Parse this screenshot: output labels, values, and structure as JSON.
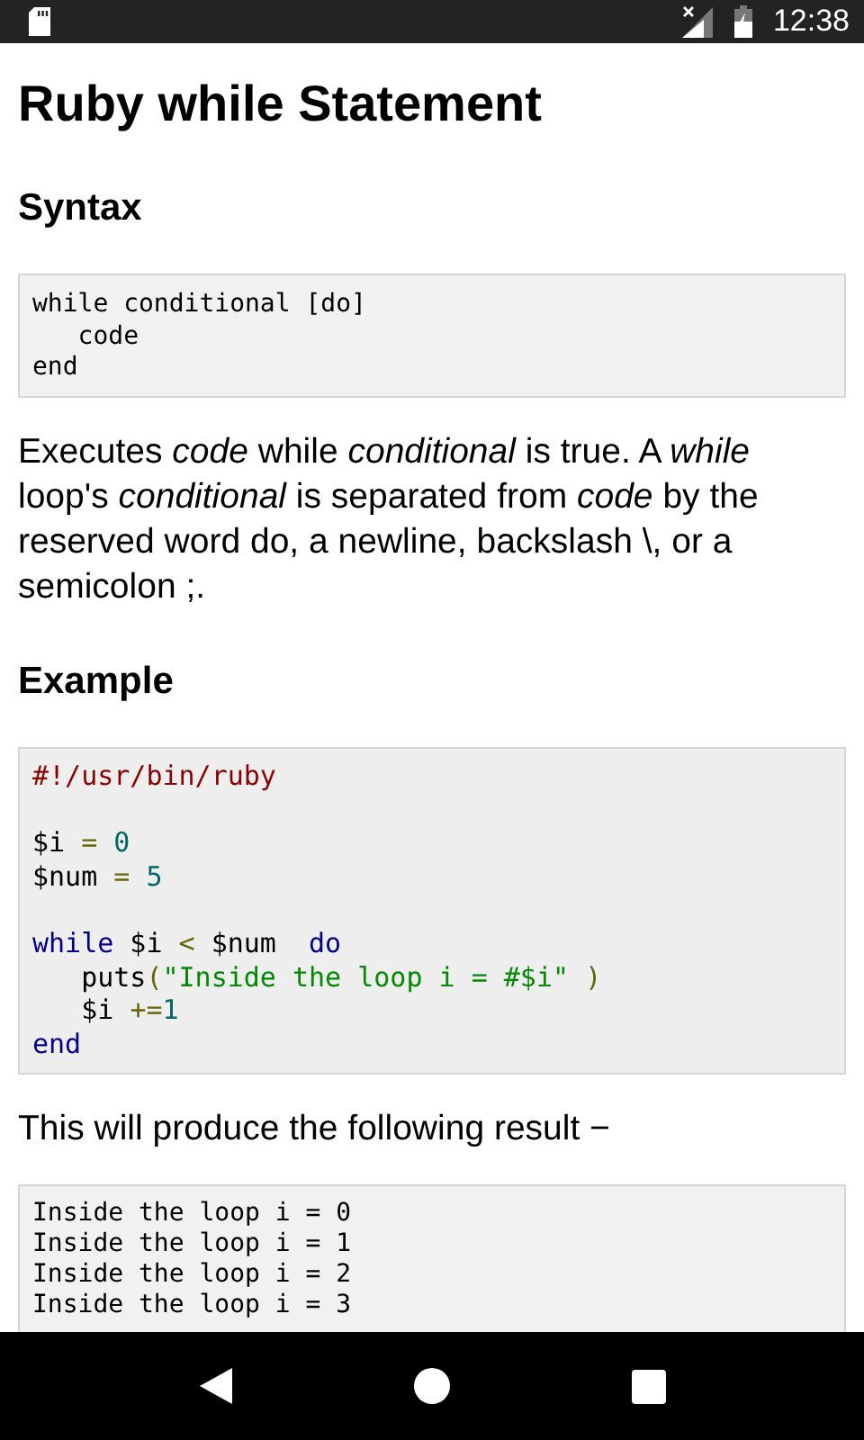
{
  "status_bar": {
    "time": "12:38"
  },
  "title": "Ruby while Statement",
  "sections": [
    {
      "kind": "heading",
      "text": "Syntax"
    },
    {
      "kind": "syntax",
      "lines": [
        {
          "kind": "code",
          "tokens": [
            {
              "kind": "plain",
              "text": "while conditional [do]"
            }
          ]
        },
        {
          "kind": "code",
          "tokens": [
            {
              "kind": "plain",
              "text": "   code"
            }
          ]
        },
        {
          "kind": "code",
          "tokens": [
            {
              "kind": "plain",
              "text": "end"
            }
          ]
        }
      ]
    },
    {
      "kind": "paragraph",
      "text": "Executes *code* while *conditional* is true. A *while* loop's *conditional* is separated from *code* by the reserved word do, a newline, backslash \\, or a semicolon ;."
    },
    {
      "kind": "heading",
      "text": "Example"
    },
    {
      "kind": "example",
      "lines": [
        {
          "kind": "code",
          "tokens": [
            {
              "kind": "comment",
              "text": "#!/usr/bin/ruby"
            }
          ]
        },
        {
          "kind": "blank"
        },
        {
          "kind": "code",
          "tokens": [
            {
              "kind": "plain",
              "text": "$i "
            },
            {
              "kind": "operator",
              "text": "="
            },
            {
              "kind": "number",
              "text": " 0"
            }
          ]
        },
        {
          "kind": "code",
          "tokens": [
            {
              "kind": "plain",
              "text": "$num "
            },
            {
              "kind": "operator",
              "text": "="
            },
            {
              "kind": "number",
              "text": " 5"
            }
          ]
        },
        {
          "kind": "blank"
        },
        {
          "kind": "code",
          "tokens": [
            {
              "kind": "keyword",
              "text": "while"
            },
            {
              "kind": "plain",
              "text": " $i "
            },
            {
              "kind": "operator",
              "text": "<"
            },
            {
              "kind": "plain",
              "text": " $num  "
            },
            {
              "kind": "keyword",
              "text": "do"
            }
          ]
        },
        {
          "kind": "code",
          "tokens": [
            {
              "kind": "plain",
              "text": "   puts"
            },
            {
              "kind": "operator",
              "text": "("
            },
            {
              "kind": "string",
              "text": "\"Inside the loop i = #$i\" "
            },
            {
              "kind": "operator",
              "text": ")"
            }
          ]
        },
        {
          "kind": "code",
          "tokens": [
            {
              "kind": "plain",
              "text": "   $i "
            },
            {
              "kind": "operator",
              "text": "+="
            },
            {
              "kind": "number",
              "text": "1"
            }
          ]
        },
        {
          "kind": "code",
          "tokens": [
            {
              "kind": "keyword",
              "text": "end"
            }
          ]
        }
      ]
    },
    {
      "kind": "paragraph",
      "text": "This will produce the following result −"
    },
    {
      "kind": "output",
      "lines": [
        {
          "kind": "code",
          "tokens": [
            {
              "kind": "plain",
              "text": "Inside the loop i = 0"
            }
          ]
        },
        {
          "kind": "code",
          "tokens": [
            {
              "kind": "plain",
              "text": "Inside the loop i = 1"
            }
          ]
        },
        {
          "kind": "code",
          "tokens": [
            {
              "kind": "plain",
              "text": "Inside the loop i = 2"
            }
          ]
        },
        {
          "kind": "code",
          "tokens": [
            {
              "kind": "plain",
              "text": "Inside the loop i = 3"
            }
          ]
        }
      ]
    }
  ]
}
